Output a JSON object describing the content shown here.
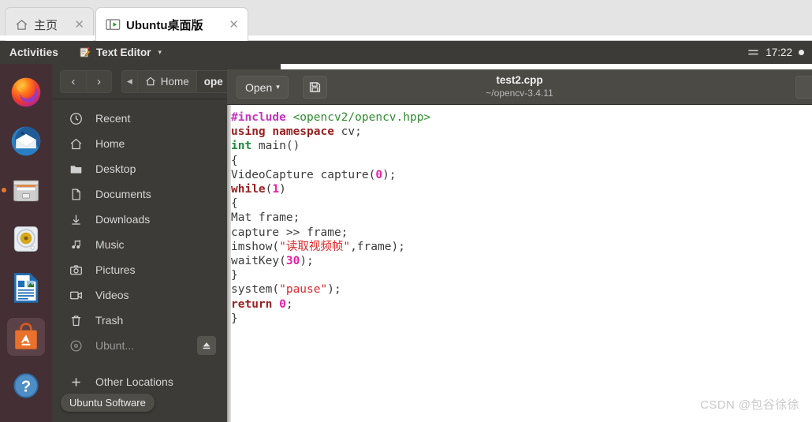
{
  "browser": {
    "tabs": [
      {
        "title": "主页",
        "icon": "home-icon",
        "close_label": "✕",
        "active": false
      },
      {
        "title": "Ubuntu桌面版",
        "icon": "play-window-icon",
        "close_label": "✕",
        "active": true
      }
    ]
  },
  "topbar": {
    "activities": "Activities",
    "app_menu": {
      "label": "Text Editor",
      "icon": "notepad-pencil-icon",
      "caret": "▾"
    },
    "clock": "17:22",
    "menu_icon": "hamburger-icon",
    "status_dot": "power-indicator"
  },
  "dock": {
    "items": [
      {
        "name": "firefox",
        "label": "Firefox",
        "running": false,
        "highlighted": false
      },
      {
        "name": "thunderbird",
        "label": "Thunderbird Mail",
        "running": false,
        "highlighted": false
      },
      {
        "name": "files",
        "label": "Files",
        "running": true,
        "highlighted": false
      },
      {
        "name": "rhythmbox",
        "label": "Rhythmbox",
        "running": false,
        "highlighted": false
      },
      {
        "name": "libreoffice-writer",
        "label": "LibreOffice Writer",
        "running": false,
        "highlighted": false
      },
      {
        "name": "ubuntu-software",
        "label": "Ubuntu Software",
        "running": false,
        "highlighted": true
      },
      {
        "name": "help",
        "label": "Help",
        "running": false,
        "highlighted": false
      }
    ]
  },
  "file_manager": {
    "nav": {
      "back": "‹",
      "forward": "›",
      "collapse": "◂"
    },
    "breadcrumbs": [
      {
        "label": "Home",
        "icon": "home-icon"
      },
      {
        "label": "ope"
      }
    ],
    "sidebar_items": [
      {
        "label": "Recent",
        "icon": "clock-icon"
      },
      {
        "label": "Home",
        "icon": "home-icon"
      },
      {
        "label": "Desktop",
        "icon": "folder-icon"
      },
      {
        "label": "Documents",
        "icon": "document-icon"
      },
      {
        "label": "Downloads",
        "icon": "download-icon"
      },
      {
        "label": "Music",
        "icon": "music-note-icon"
      },
      {
        "label": "Pictures",
        "icon": "camera-icon"
      },
      {
        "label": "Videos",
        "icon": "film-icon"
      },
      {
        "label": "Trash",
        "icon": "trash-icon"
      }
    ],
    "drive": {
      "label": "Ubunt...",
      "icon": "disc-icon",
      "eject_icon": "eject-icon"
    },
    "other_locations": {
      "label": "Other Locations",
      "icon": "plus-icon"
    },
    "tooltip": "Ubuntu Software"
  },
  "editor": {
    "open_button": {
      "label": "Open",
      "caret": "▾"
    },
    "save_icon": "save-icon",
    "title": "test2.cpp",
    "subtitle": "~/opencv-3.4.11",
    "code_lines": [
      [
        {
          "t": "#include ",
          "c": "k-pre"
        },
        {
          "t": "<opencv2/opencv.hpp>",
          "c": "k-inc"
        }
      ],
      [
        {
          "t": "using namespace",
          "c": "k-kw"
        },
        {
          "t": " cv;",
          "c": "k-pln"
        }
      ],
      [
        {
          "t": "int",
          "c": "k-type"
        },
        {
          "t": " main()",
          "c": "k-pln"
        }
      ],
      [
        {
          "t": "{",
          "c": "k-pln"
        }
      ],
      [
        {
          "t": "VideoCapture capture(",
          "c": "k-pln"
        },
        {
          "t": "0",
          "c": "k-num"
        },
        {
          "t": ");",
          "c": "k-pln"
        }
      ],
      [
        {
          "t": "while",
          "c": "k-kw"
        },
        {
          "t": "(",
          "c": "k-pln"
        },
        {
          "t": "1",
          "c": "k-num"
        },
        {
          "t": ")",
          "c": "k-pln"
        }
      ],
      [
        {
          "t": "{",
          "c": "k-pln"
        }
      ],
      [
        {
          "t": "Mat frame;",
          "c": "k-pln"
        }
      ],
      [
        {
          "t": "capture >> frame;",
          "c": "k-pln"
        }
      ],
      [
        {
          "t": "imshow(",
          "c": "k-pln"
        },
        {
          "t": "\"读取视频帧\"",
          "c": "k-str"
        },
        {
          "t": ",frame);",
          "c": "k-pln"
        }
      ],
      [
        {
          "t": "waitKey(",
          "c": "k-pln"
        },
        {
          "t": "30",
          "c": "k-num"
        },
        {
          "t": ");",
          "c": "k-pln"
        }
      ],
      [
        {
          "t": "}",
          "c": "k-pln"
        }
      ],
      [
        {
          "t": "system(",
          "c": "k-pln"
        },
        {
          "t": "\"pause\"",
          "c": "k-str"
        },
        {
          "t": ");",
          "c": "k-pln"
        }
      ],
      [
        {
          "t": "return",
          "c": "k-kw"
        },
        {
          "t": " ",
          "c": "k-pln"
        },
        {
          "t": "0",
          "c": "k-num"
        },
        {
          "t": ";",
          "c": "k-pln"
        }
      ],
      [
        {
          "t": "}",
          "c": "k-pln"
        }
      ]
    ]
  },
  "watermark": "CSDN @包谷徐徐",
  "colors": {
    "ubuntu_purple": "#432f34",
    "panel_dark": "#3c3b37",
    "accent_orange": "#e8762b",
    "editor_header": "#4b4a45"
  }
}
